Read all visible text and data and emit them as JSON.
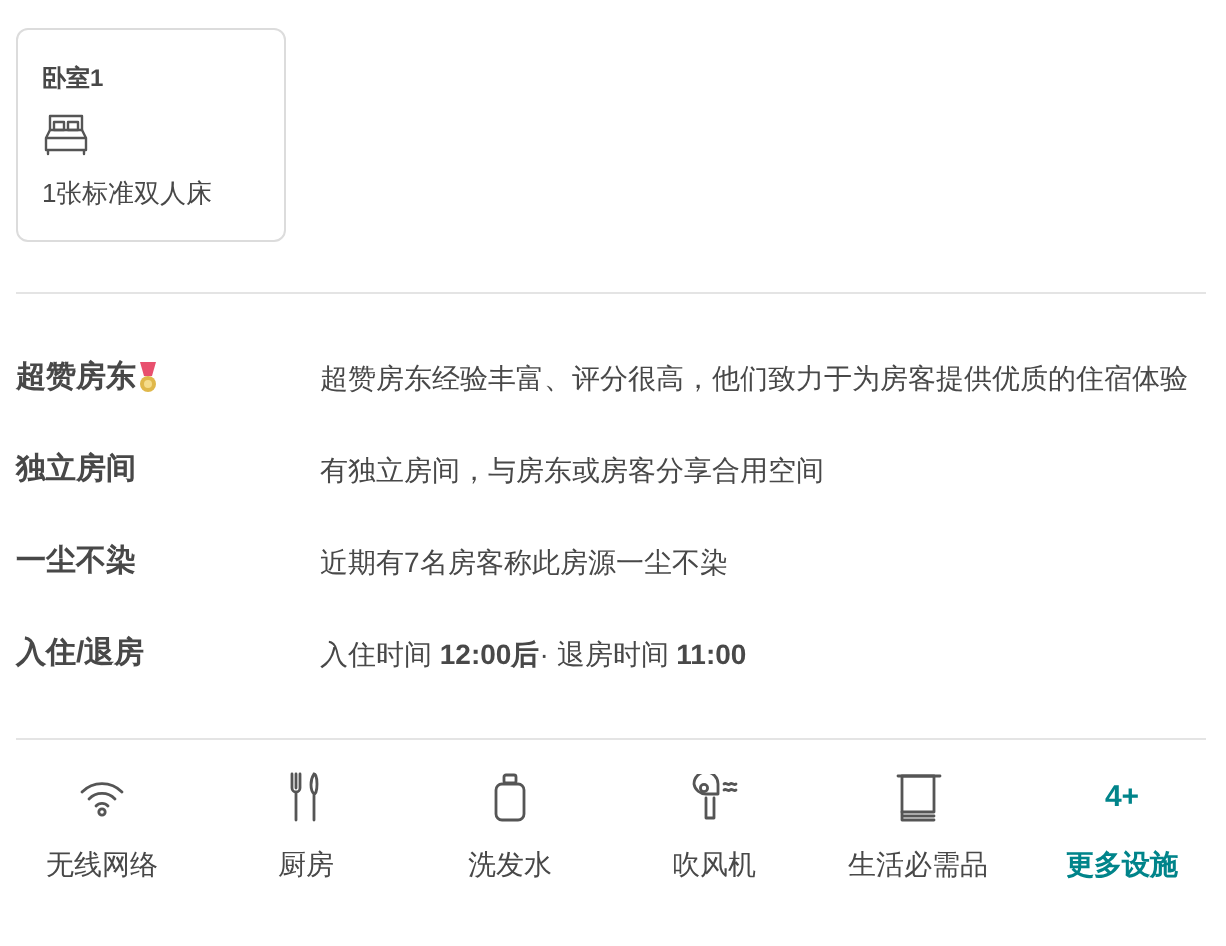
{
  "bedroom": {
    "title": "卧室1",
    "bed": "1张标准双人床"
  },
  "highlights": [
    {
      "label": "超赞房东",
      "badge": true,
      "text": "超赞房东经验丰富、评分很高，他们致力于为房客提供优质的住宿体验"
    },
    {
      "label": "独立房间",
      "badge": false,
      "text": "有独立房间，与房东或房客分享合用空间"
    },
    {
      "label": "一尘不染",
      "badge": false,
      "text": "近期有7名房客称此房源一尘不染"
    },
    {
      "label": "入住/退房",
      "badge": false,
      "text": "入住时间 **12:00后**· 退房时间 **11:00**"
    }
  ],
  "amenities": [
    {
      "kind": "amenity",
      "label": "无线网络"
    },
    {
      "kind": "amenity",
      "label": "厨房"
    },
    {
      "kind": "amenity",
      "label": "洗发水"
    },
    {
      "kind": "amenity",
      "label": "吹风机"
    },
    {
      "kind": "amenity",
      "label": "生活必需品"
    },
    {
      "kind": "more",
      "count": "4+",
      "label": "更多设施"
    }
  ]
}
